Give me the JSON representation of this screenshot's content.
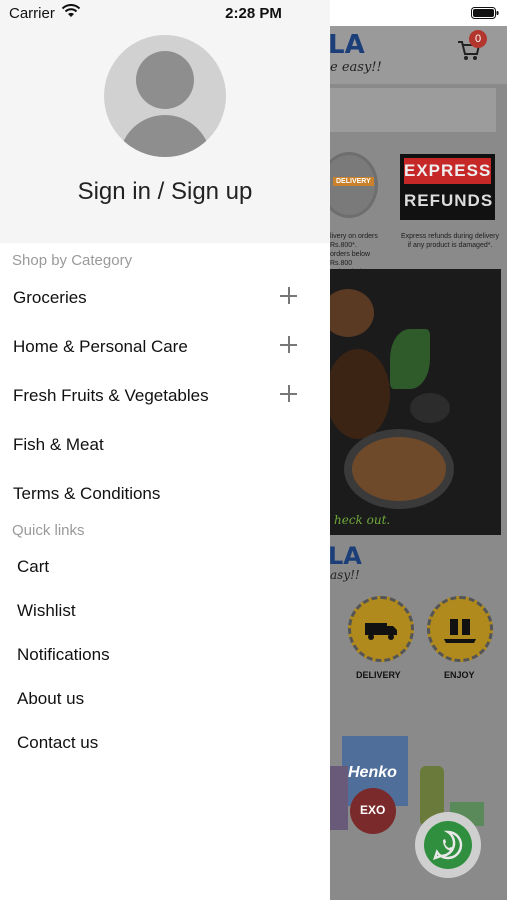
{
  "status_bar": {
    "carrier": "Carrier",
    "time": "2:28 PM"
  },
  "drawer": {
    "sign_in_label": "Sign in / Sign up",
    "category_section_title": "Shop by Category",
    "categories": [
      {
        "label": "Groceries",
        "expandable": true
      },
      {
        "label": "Home & Personal Care",
        "expandable": true
      },
      {
        "label": "Fresh Fruits & Vegetables",
        "expandable": true
      },
      {
        "label": "Fish & Meat",
        "expandable": false
      },
      {
        "label": "Terms & Conditions",
        "expandable": false
      }
    ],
    "quick_links_title": "Quick links",
    "quick_links": [
      {
        "label": "Cart"
      },
      {
        "label": "Wishlist"
      },
      {
        "label": "Notifications"
      },
      {
        "label": "About us"
      },
      {
        "label": "Contact us"
      }
    ]
  },
  "background_page": {
    "logo_fragment": "LA",
    "tagline_fragment": "e easy!!",
    "cart_count": "0",
    "badge_free_text": "DELIVERY",
    "express_line1": "EXPRESS",
    "express_line2": "REFUNDS",
    "free_delivery_note": "livery on orders\nRs.800*.\norders below Rs.800\norders below 400",
    "express_note": "Express refunds during delivery\nif any product is damaged*.",
    "banner_caption": "heck out.",
    "logo_fragment_2": "LA",
    "tagline_fragment_2": "asy!!",
    "feature_1_label": "DELIVERY",
    "feature_2_label": "ENJOY",
    "product_brand_1": "Henko",
    "product_brand_2": "EXO"
  },
  "colors": {
    "cart_badge": "#b2362e",
    "express_red": "#c62828",
    "whatsapp_green": "#2f8f3e"
  }
}
